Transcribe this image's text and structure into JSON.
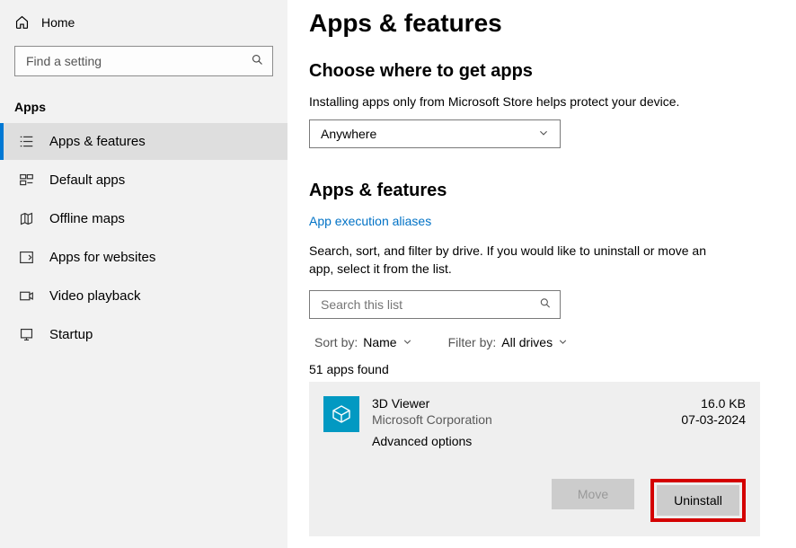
{
  "sidebar": {
    "home_label": "Home",
    "search_placeholder": "Find a setting",
    "section_label": "Apps",
    "items": [
      {
        "label": "Apps & features"
      },
      {
        "label": "Default apps"
      },
      {
        "label": "Offline maps"
      },
      {
        "label": "Apps for websites"
      },
      {
        "label": "Video playback"
      },
      {
        "label": "Startup"
      }
    ]
  },
  "main": {
    "title": "Apps & features",
    "source_heading": "Choose where to get apps",
    "source_help": "Installing apps only from Microsoft Store helps protect your device.",
    "source_value": "Anywhere",
    "af_heading": "Apps & features",
    "aliases_link": "App execution aliases",
    "list_desc": "Search, sort, and filter by drive. If you would like to uninstall or move an app, select it from the list.",
    "list_search_placeholder": "Search this list",
    "sort_label": "Sort by:",
    "sort_value": "Name",
    "filter_label": "Filter by:",
    "filter_value": "All drives",
    "count_text": "51 apps found",
    "app": {
      "name": "3D Viewer",
      "publisher": "Microsoft Corporation",
      "adv": "Advanced options",
      "size": "16.0 KB",
      "date": "07-03-2024"
    },
    "move_label": "Move",
    "uninstall_label": "Uninstall"
  }
}
